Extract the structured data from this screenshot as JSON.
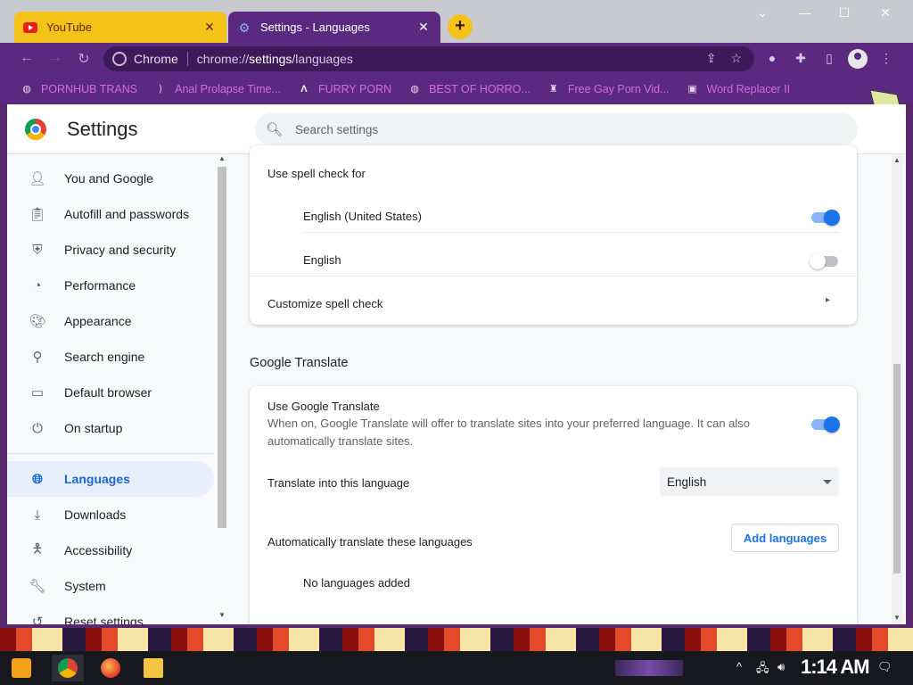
{
  "browser": {
    "tabs": [
      {
        "title": "YouTube",
        "active": false
      },
      {
        "title": "Settings - Languages",
        "active": true
      }
    ],
    "new_tab_label": "+",
    "omnibox": {
      "site_label": "Chrome",
      "url_prefix": "chrome://",
      "url_host": "settings",
      "url_path": "/languages"
    },
    "bookmarks": [
      {
        "label": "PORNHUB TRANS",
        "icon": "globe-icon"
      },
      {
        "label": "Anal Prolapse Time...",
        "icon": "bookmark-folder-icon"
      },
      {
        "label": "FURRY PORN",
        "icon": "lambda-logo-icon"
      },
      {
        "label": "BEST OF HORRO...",
        "icon": "globe-icon"
      },
      {
        "label": "Free Gay Porn Vid...",
        "icon": "site-favicon-icon"
      },
      {
        "label": "Word Replacer II",
        "icon": "extension-icon"
      }
    ]
  },
  "settings": {
    "title": "Settings",
    "search_placeholder": "Search settings",
    "nav": [
      {
        "label": "You and Google",
        "icon": "person-icon",
        "active": false
      },
      {
        "label": "Autofill and passwords",
        "icon": "clipboard-icon",
        "active": false
      },
      {
        "label": "Privacy and security",
        "icon": "shield-icon",
        "active": false
      },
      {
        "label": "Performance",
        "icon": "speedometer-icon",
        "active": false
      },
      {
        "label": "Appearance",
        "icon": "palette-icon",
        "active": false
      },
      {
        "label": "Search engine",
        "icon": "search-icon",
        "active": false
      },
      {
        "label": "Default browser",
        "icon": "browser-window-icon",
        "active": false
      },
      {
        "label": "On startup",
        "icon": "power-icon",
        "active": false
      },
      {
        "label": "Languages",
        "icon": "globe-icon",
        "active": true
      },
      {
        "label": "Downloads",
        "icon": "download-icon",
        "active": false
      },
      {
        "label": "Accessibility",
        "icon": "accessibility-icon",
        "active": false
      },
      {
        "label": "System",
        "icon": "wrench-icon",
        "active": false
      },
      {
        "label": "Reset settings",
        "icon": "history-icon",
        "active": false
      }
    ],
    "spell_check": {
      "heading": "Use spell check for",
      "languages": [
        {
          "label": "English (United States)",
          "enabled": true
        },
        {
          "label": "English",
          "enabled": false
        }
      ],
      "customize_label": "Customize spell check"
    },
    "google_translate": {
      "section_title": "Google Translate",
      "use_label": "Use Google Translate",
      "use_description": "When on, Google Translate will offer to translate sites into your preferred language. It can also automatically translate sites.",
      "use_enabled": true,
      "translate_into_label": "Translate into this language",
      "translate_into_value": "English",
      "auto_translate_label": "Automatically translate these languages",
      "add_languages_label": "Add languages",
      "no_languages_label": "No languages added"
    }
  },
  "taskbar": {
    "clock": "1:14 AM"
  },
  "colors": {
    "accent": "#1a73e8",
    "browser_frame": "#5b2a80",
    "bookmark_text": "#d46be0",
    "youtube_tab": "#f5c21a"
  }
}
